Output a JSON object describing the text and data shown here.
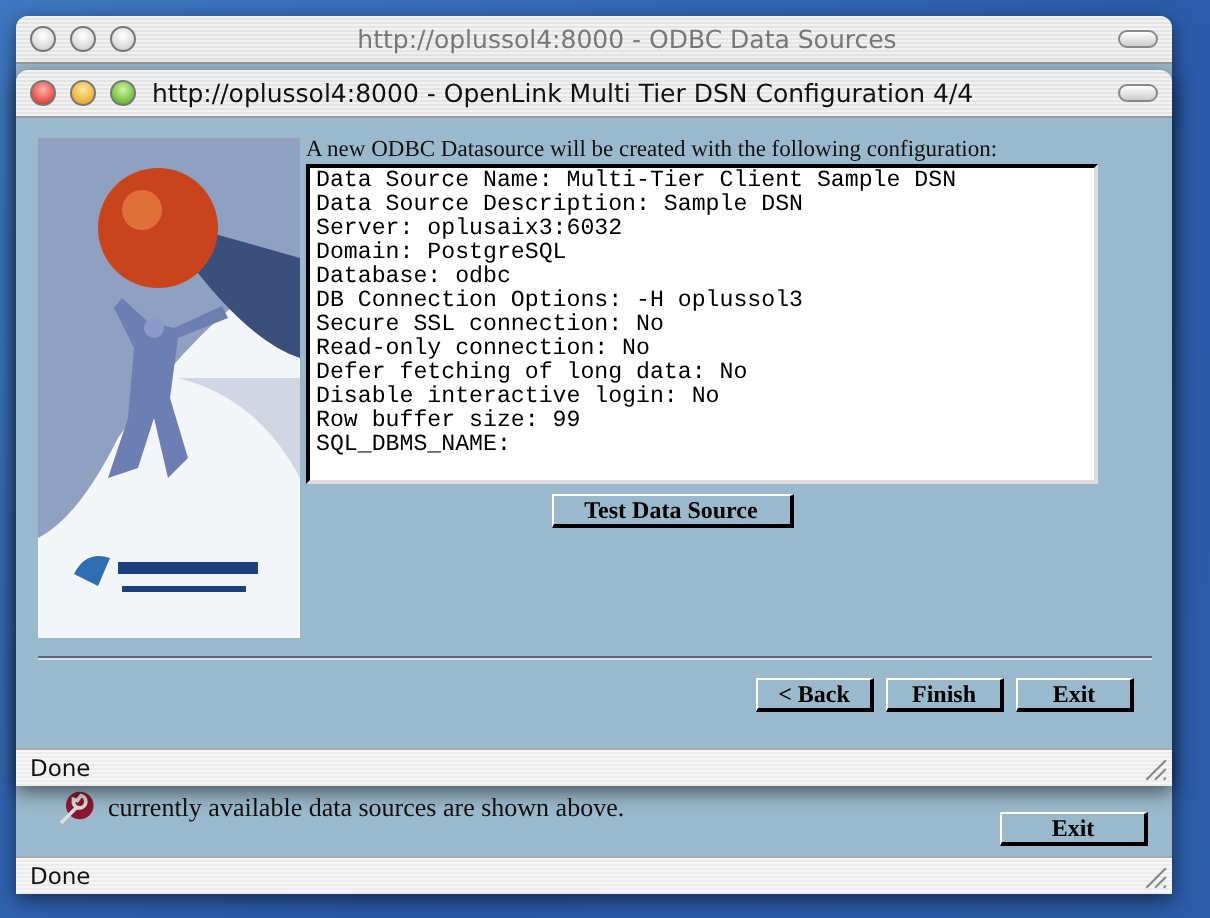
{
  "back_window": {
    "title": "http://oplussol4:8000 - ODBC Data Sources",
    "note": "currently available data sources are shown above.",
    "buttons": [
      "Exit"
    ],
    "status_bar": "Done"
  },
  "front_window": {
    "title": "http://oplussol4:8000 - OpenLink Multi Tier DSN Configuration 4/4",
    "intro": "A new ODBC Datasource will be created with the following configuration:",
    "config_lines": [
      "Data Source Name: Multi-Tier Client Sample DSN",
      "Data Source Description: Sample DSN",
      "Server: oplusaix3:6032",
      "Domain: PostgreSQL",
      "Database: odbc",
      "DB Connection Options: -H oplussol3",
      "Secure SSL connection: No",
      "Read-only connection: No",
      "Defer fetching of long data: No",
      "Disable interactive login: No",
      "Row buffer size: 99",
      "SQL_DBMS_NAME:"
    ],
    "test_button": "Test Data Source",
    "buttons": [
      "< Back",
      "Finish",
      "Exit"
    ],
    "status_bar": "Done"
  }
}
